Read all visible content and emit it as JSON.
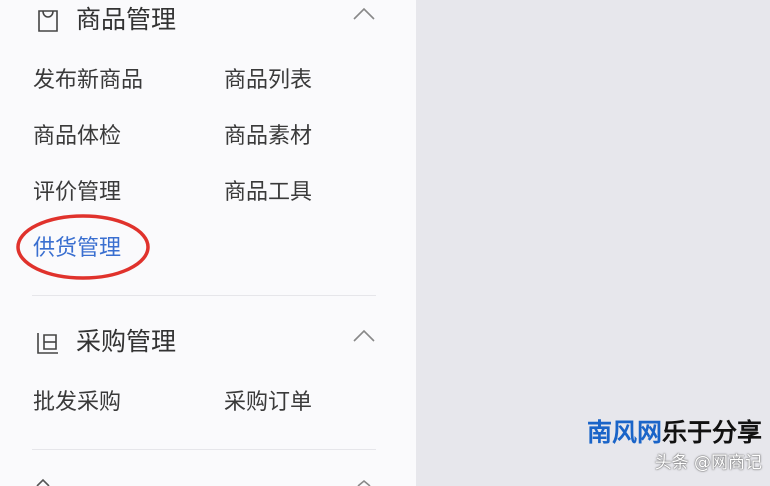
{
  "sections": [
    {
      "title": "商品管理",
      "icon": "shopping-bag-icon",
      "expanded": true,
      "items": [
        "发布新商品",
        "商品列表",
        "商品体检",
        "商品素材",
        "评价管理",
        "商品工具",
        "供货管理"
      ],
      "highlighted_item": "供货管理"
    },
    {
      "title": "采购管理",
      "icon": "purchase-icon",
      "expanded": true,
      "items": [
        "批发采购",
        "采购订单"
      ]
    }
  ],
  "watermark": {
    "brand_part1": "南风网",
    "brand_part2": "乐于分享",
    "sub": "头条 @网商记"
  },
  "colors": {
    "active_link": "#3a6fd0",
    "highlight_ring": "#e0322c",
    "brand_blue": "#1a64c8"
  }
}
